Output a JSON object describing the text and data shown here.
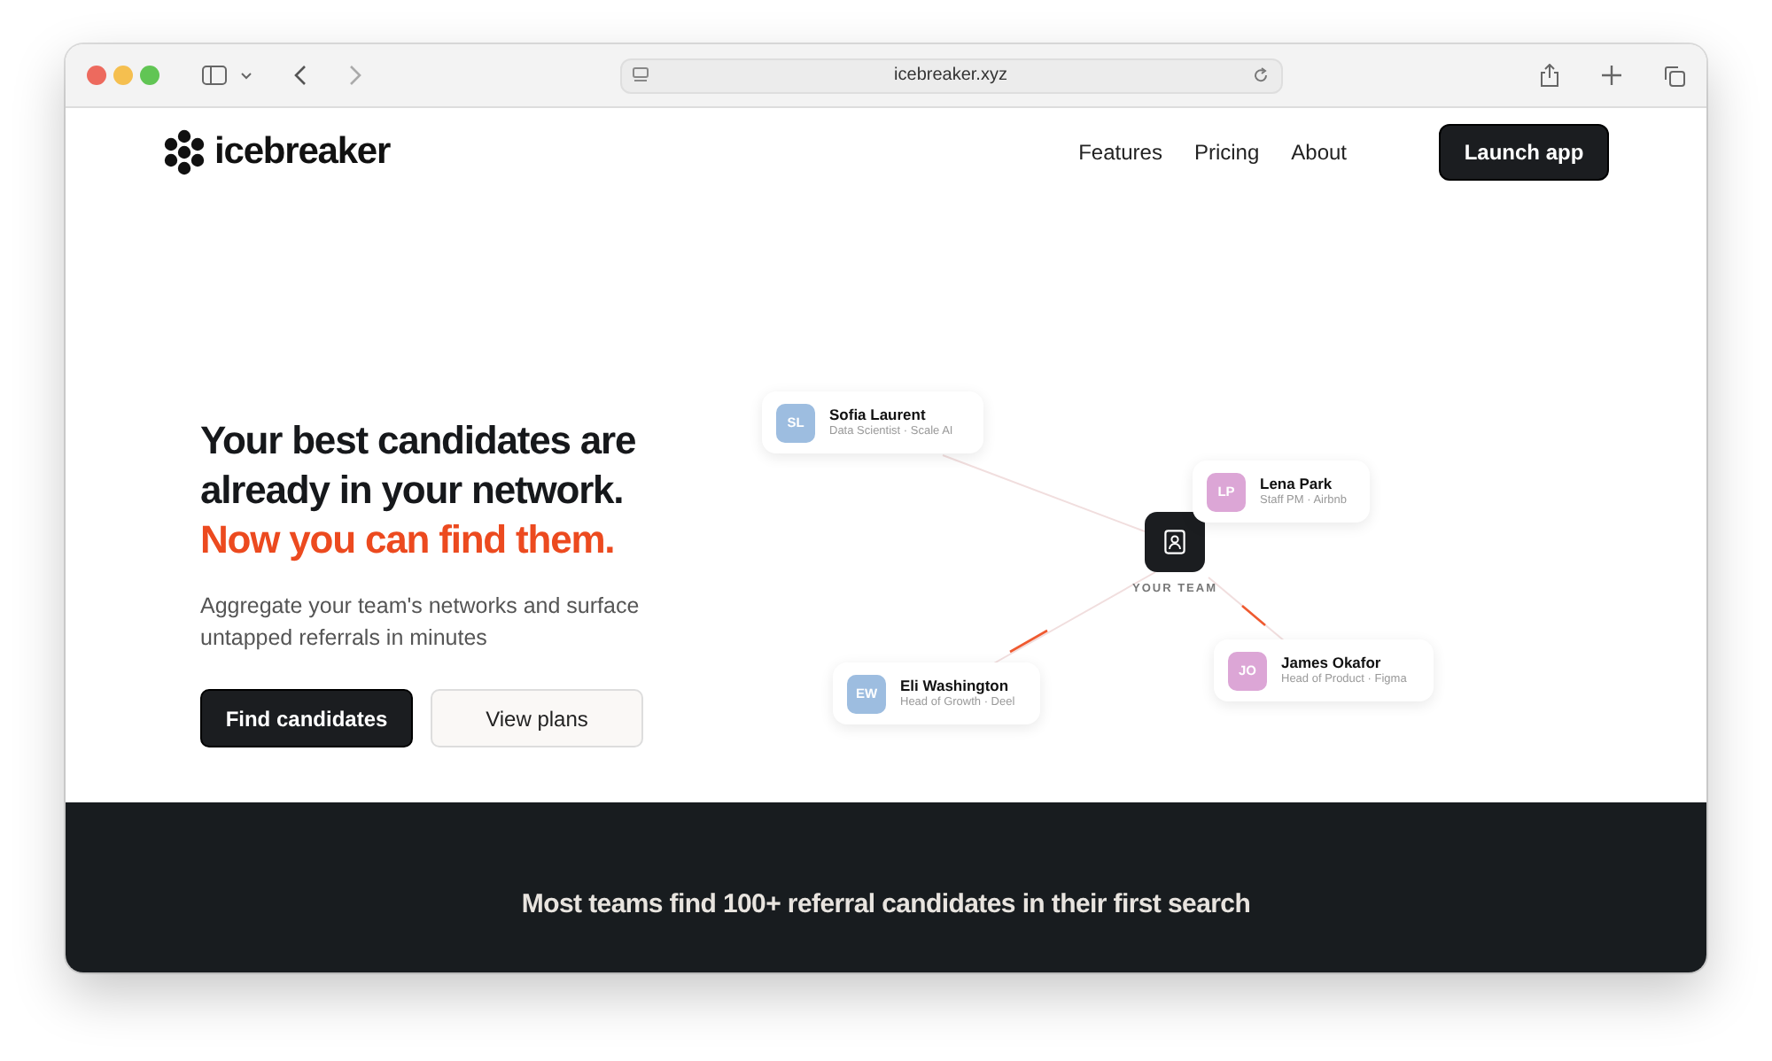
{
  "browser": {
    "url": "icebreaker.xyz"
  },
  "nav": {
    "logo_text": "icebreaker",
    "links": [
      "Features",
      "Pricing",
      "About"
    ],
    "cta": "Launch app"
  },
  "hero": {
    "headline_lines": [
      "Your best candidates are",
      "already in your network."
    ],
    "accent": "Now you can find them.",
    "subtitle": "Aggregate your team's networks and surface untapped referrals in minutes",
    "buttons": [
      {
        "label": "Find candidates",
        "kind": "primary"
      },
      {
        "label": "View plans",
        "kind": "secondary"
      }
    ]
  },
  "diagram": {
    "center_label": "YOUR TEAM",
    "people": [
      {
        "initials": "SL",
        "name": "Sofia Laurent",
        "role": "Data Scientist · Scale AI",
        "color": "#9dbde0"
      },
      {
        "initials": "LP",
        "name": "Lena Park",
        "role": "Staff PM · Airbnb",
        "color": "#dca6d6"
      },
      {
        "initials": "EW",
        "name": "Eli Washington",
        "role": "Head of Growth · Deel",
        "color": "#9dbde0"
      },
      {
        "initials": "JO",
        "name": "James Okafor",
        "role": "Head of Product · Figma",
        "color": "#dca6d6"
      }
    ]
  },
  "stat_band": {
    "text": "Most teams find 100+ referral candidates in their first search"
  }
}
